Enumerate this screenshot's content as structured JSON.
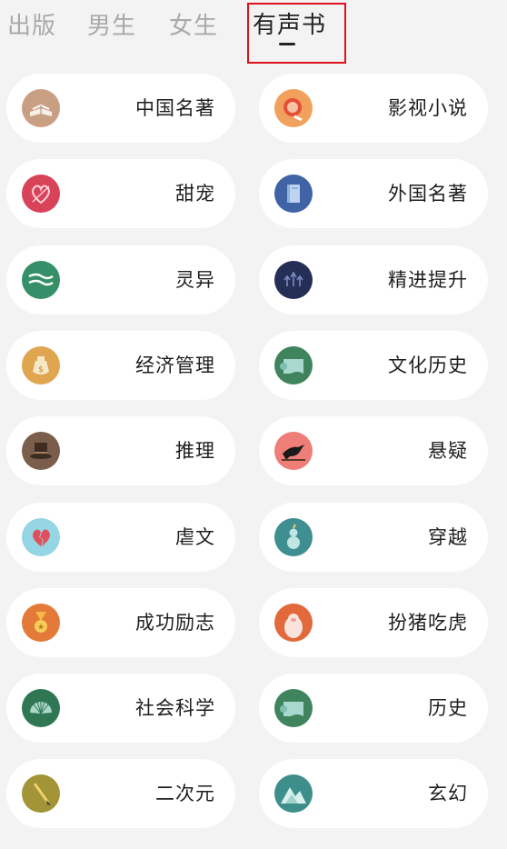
{
  "tabs": [
    {
      "label": "出版",
      "active": false
    },
    {
      "label": "男生",
      "active": false
    },
    {
      "label": "女生",
      "active": false
    },
    {
      "label": "有声书",
      "active": true
    }
  ],
  "highlight_color": "#e0101c",
  "categories": [
    {
      "label": "中国名著",
      "icon": "open-book-icon",
      "color": "#c99f84"
    },
    {
      "label": "影视小说",
      "icon": "film-reel-icon",
      "color": "#f2a15c"
    },
    {
      "label": "甜宠",
      "icon": "heart-icon",
      "color": "#d9435a"
    },
    {
      "label": "外国名著",
      "icon": "book-icon",
      "color": "#3f63a5"
    },
    {
      "label": "灵异",
      "icon": "wave-icon",
      "color": "#35906a"
    },
    {
      "label": "精进提升",
      "icon": "arrows-up-icon",
      "color": "#252e55"
    },
    {
      "label": "经济管理",
      "icon": "money-bag-icon",
      "color": "#e0a64f"
    },
    {
      "label": "文化历史",
      "icon": "scroll-icon",
      "color": "#3f845c"
    },
    {
      "label": "推理",
      "icon": "top-hat-icon",
      "color": "#7a5d4a"
    },
    {
      "label": "悬疑",
      "icon": "crow-icon",
      "color": "#ef7d78"
    },
    {
      "label": "虐文",
      "icon": "broken-heart-icon",
      "color": "#95d5e4"
    },
    {
      "label": "穿越",
      "icon": "gourd-icon",
      "color": "#3f8e92"
    },
    {
      "label": "成功励志",
      "icon": "medal-icon",
      "color": "#e37a38"
    },
    {
      "label": "扮猪吃虎",
      "icon": "pig-icon",
      "color": "#e1693b"
    },
    {
      "label": "社会科学",
      "icon": "fan-icon",
      "color": "#2f7653"
    },
    {
      "label": "历史",
      "icon": "scroll-icon",
      "color": "#3f845c"
    },
    {
      "label": "二次元",
      "icon": "brush-icon",
      "color": "#a29437"
    },
    {
      "label": "玄幻",
      "icon": "mountain-icon",
      "color": "#3e8e8c"
    }
  ]
}
